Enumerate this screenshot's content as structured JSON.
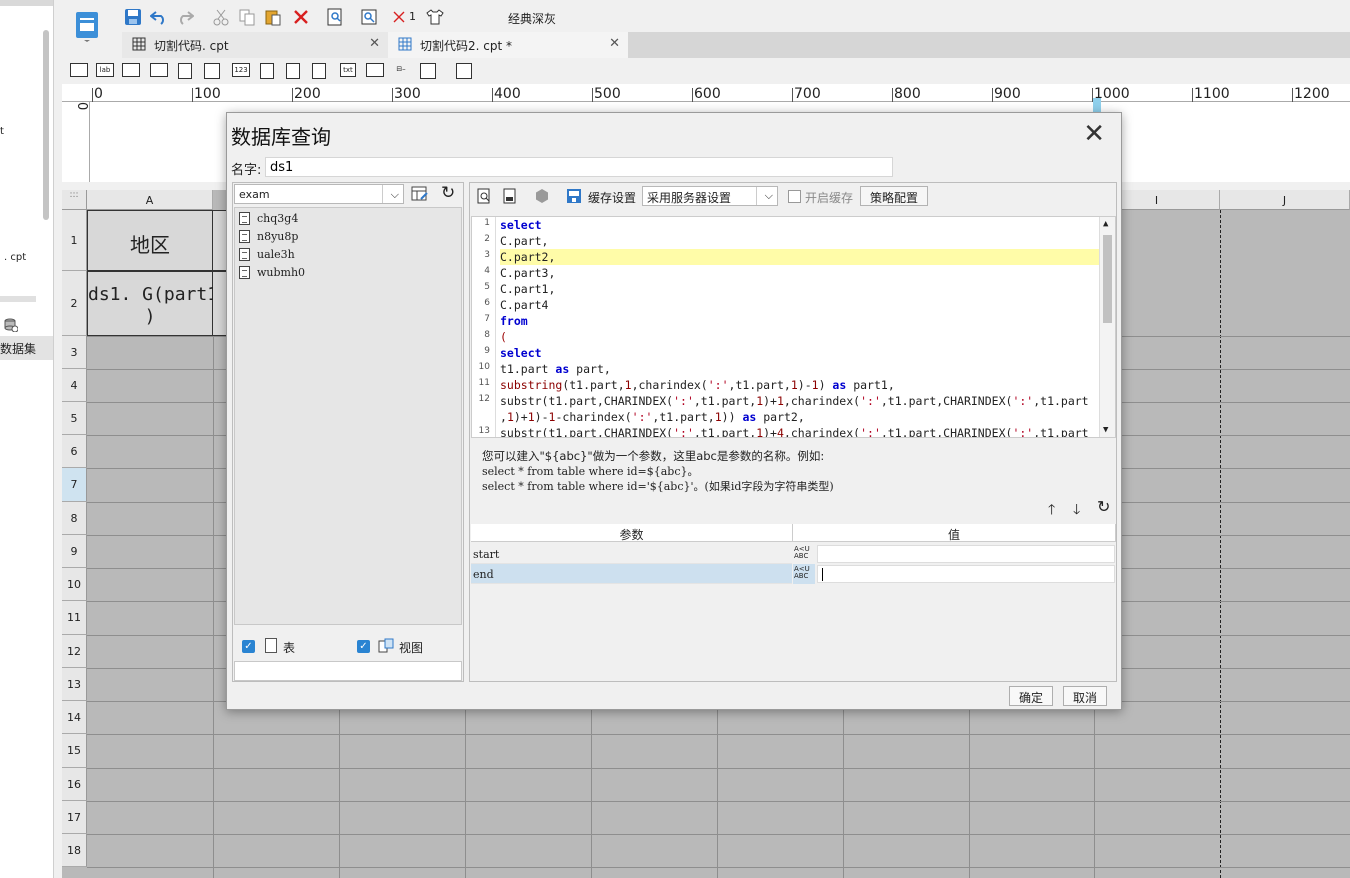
{
  "left_panel": {
    "fragment_top": "t",
    "fragment_file": ". cpt",
    "dataset_label": "数据集"
  },
  "toolbar": {
    "undo_count": "1",
    "theme_label": "经典深灰"
  },
  "tabs": [
    {
      "label": "切割代码. cpt"
    },
    {
      "label": "切割代码2. cpt *"
    }
  ],
  "widget_icons": [
    "lab",
    "123",
    "txt"
  ],
  "ruler": {
    "marks": [
      "0",
      "100",
      "200",
      "300",
      "400",
      "500",
      "600",
      "700",
      "800",
      "900",
      "1000",
      "1100",
      "1200"
    ],
    "v_zero": "0"
  },
  "sheet": {
    "corner_label": ":::",
    "columns": [
      "A",
      "I",
      "J"
    ],
    "rows": [
      "1",
      "2",
      "3",
      "4",
      "5",
      "6",
      "7",
      "8",
      "9",
      "10",
      "11",
      "12",
      "13",
      "14",
      "15",
      "16",
      "17",
      "18"
    ],
    "cells": {
      "a1": "地区",
      "a2": "ds1. G(part1\n)"
    }
  },
  "dialog": {
    "title": "数据库查询",
    "close_icon": "✕",
    "name_label": "名字:",
    "name_value": "ds1",
    "database": "exam",
    "tables": [
      "chq3g4",
      "n8yu8p",
      "uale3h",
      "wubmh0"
    ],
    "show_table_label": "表",
    "show_view_label": "视图",
    "cache_label": "缓存设置",
    "cache_option": "采用服务器设置",
    "enable_cache_label": "开启缓存",
    "policy_label": "策略配置",
    "sql_lines": [
      "1",
      "2",
      "3",
      "4",
      "5",
      "6",
      "7",
      "8",
      "9",
      "10",
      "11",
      "12",
      "13"
    ],
    "hint_line1": "您可以建入\"${abc}\"做为一个参数，这里abc是参数的名称。例如:",
    "hint_line2": "select * from table where id=${abc}。",
    "hint_line3": "select * from table where id='${abc}'。(如果id字段为字符串类型)",
    "param_header_name": "参数",
    "param_header_value": "值",
    "params": [
      {
        "name": "start",
        "value": ""
      },
      {
        "name": "end",
        "value": ""
      }
    ],
    "param_type_icon": "A<U ABC",
    "ok_label": "确定",
    "cancel_label": "取消"
  }
}
